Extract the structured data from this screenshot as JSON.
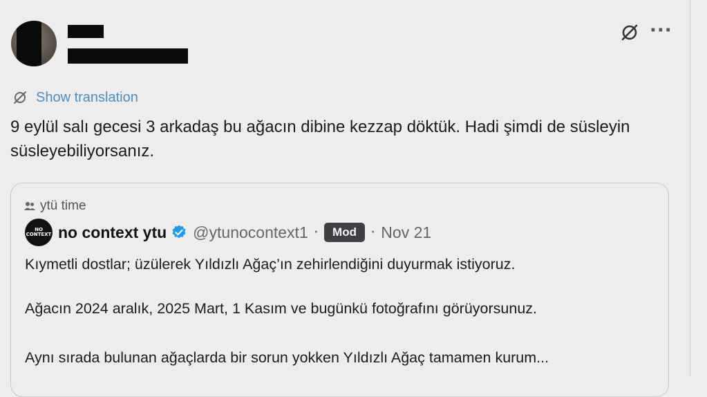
{
  "post": {
    "translate_label": "Show translation",
    "text": "9 eylül salı gecesi 3 arkadaş bu ağacın dibine kezzap döktük. Hadi şimdi de süsleyin süsleyebiliyorsanız."
  },
  "quote": {
    "community": "ytü time",
    "display_name": "no context ytu",
    "avatar_text": "NO CONTEXT",
    "handle": "@ytunocontext1",
    "separator": "·",
    "badge": "Mod",
    "date": "Nov 21",
    "lines": [
      "Kıymetli dostlar; üzülerek Yıldızlı Ağaç’ın zehirlendiğini duyurmak istiyoruz.",
      "Ağacın 2024 aralık, 2025 Mart, 1 Kasım ve bugünkü fotoğrafını görüyorsunuz.",
      "Aynı sırada bulunan ağaçlarda bir sorun yokken Yıldızlı Ağaç tamamen kurum..."
    ]
  },
  "icons": {
    "grok": "grok-icon",
    "more": "more-icon",
    "translate": "translate-icon",
    "community": "community-icon",
    "verified": "verified-badge-icon"
  },
  "colors": {
    "background": "#ededed",
    "link": "#4a8ec9",
    "verified": "#1d9bf0",
    "badge_bg": "#3e4044"
  },
  "more_glyph": "···"
}
